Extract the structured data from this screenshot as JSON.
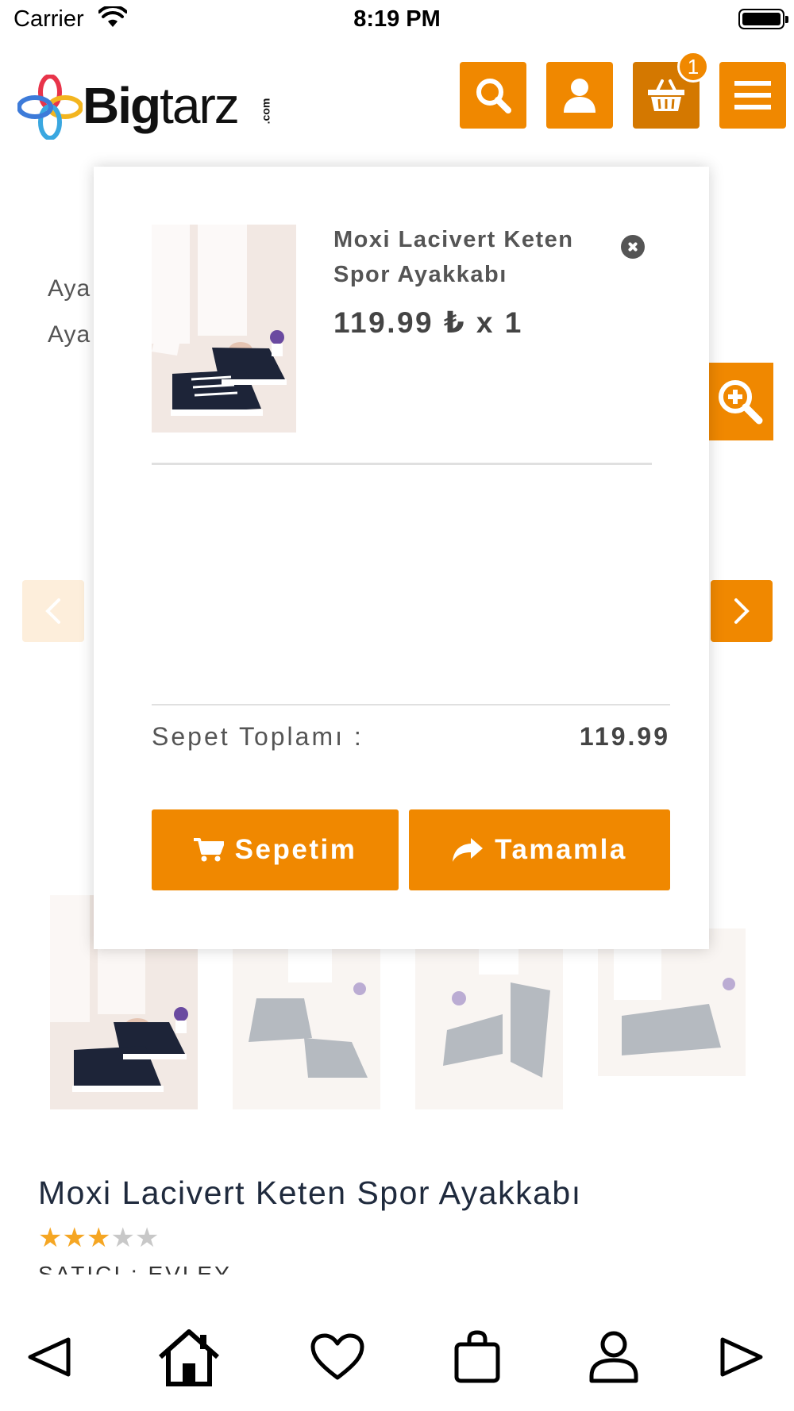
{
  "status_bar": {
    "carrier": "Carrier",
    "time": "8:19 PM"
  },
  "header": {
    "logo": {
      "text_bold": "Big",
      "text_light": "tarz",
      "suffix": ".com"
    },
    "cart_count": "1",
    "buttons": [
      "search-icon",
      "user-icon",
      "basket-icon",
      "menu-icon"
    ],
    "accent_color": "#f08800"
  },
  "background_page": {
    "partial_label_1": "Aya",
    "partial_label_2": "Aya",
    "product_title": "Moxi Lacivert Keten Spor Ayakkabı",
    "rating": 3,
    "rating_max": 5,
    "stars_on": "★★★",
    "stars_off": "★★",
    "cut_text": "SATICI : EVLEY"
  },
  "cart_popup": {
    "item": {
      "name": "Moxi Lacivert Keten Spor Ayakkabı",
      "price_line": "119.99 ₺ x 1"
    },
    "total_label": "Sepet Toplamı :",
    "total_value": "119.99",
    "buttons": {
      "cart_label": "Sepetim",
      "checkout_label": "Tamamla"
    }
  },
  "bottom_nav": [
    "back-icon",
    "home-icon",
    "heart-icon",
    "bag-icon",
    "profile-icon",
    "forward-icon"
  ]
}
